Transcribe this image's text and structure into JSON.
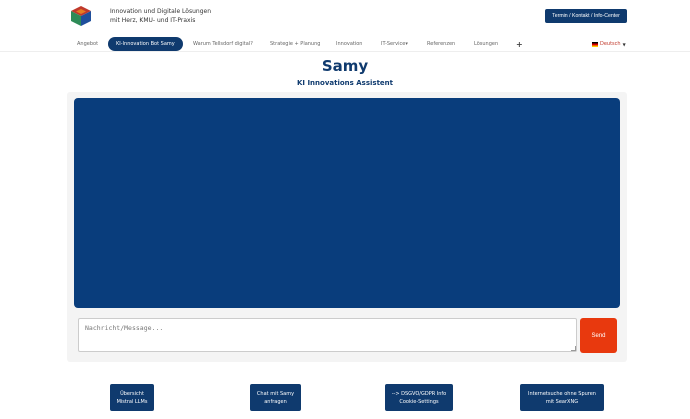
{
  "header": {
    "tagline_line1": "Innovation und Digitale Lösungen",
    "tagline_line2": "mit Herz, KMU- und IT-Praxis",
    "cta_label": "Termin / Kontakt / Info-Center"
  },
  "nav": {
    "items": [
      {
        "label": "Angebot"
      },
      {
        "label": "KI-Innovation Bot Samy"
      },
      {
        "label": "Warum Tellsdorf digital?"
      },
      {
        "label": "Strategie + Planung"
      },
      {
        "label": "Innovation"
      },
      {
        "label": "IT-Service▾"
      },
      {
        "label": "Referenzen"
      },
      {
        "label": "Lösungen"
      }
    ],
    "plus": "+",
    "language": "Deutsch",
    "active_index": 1
  },
  "page": {
    "title": "Samy",
    "subtitle": "KI Innovations Assistent"
  },
  "chat": {
    "placeholder": "Nachricht/Message...",
    "send_label": "Send",
    "area_color": "#093d7c"
  },
  "buttons": [
    {
      "label": "Übersicht\nMistral LLMs"
    },
    {
      "label": "Chat mit Samy\nanfragen"
    },
    {
      "label": "--> DSGVO/GDPR Info\nCookie-Settings"
    },
    {
      "label": "Internetsuche ohne Spuren\nmit SearXNG"
    }
  ],
  "colors": {
    "brand": "#0f3a6e",
    "accent": "#e8390e"
  },
  "icons": {
    "logo": "cube-logo-icon",
    "flag": "german-flag-icon",
    "caret": "caret-down-icon"
  }
}
